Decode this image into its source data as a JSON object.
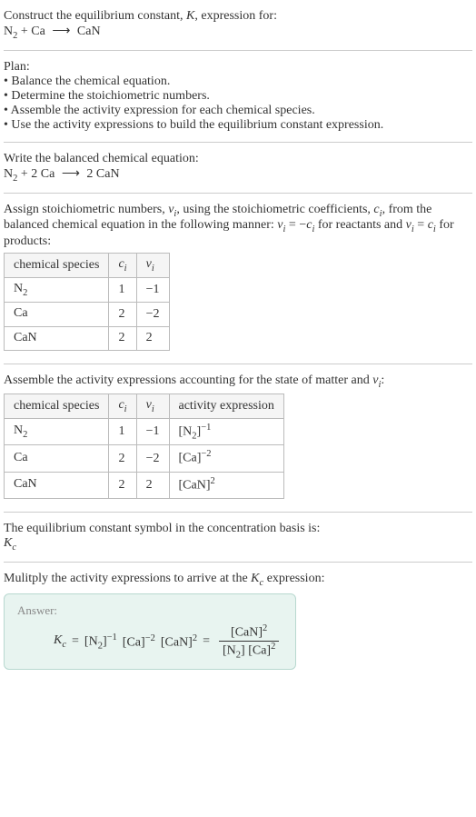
{
  "intro": {
    "line1": "Construct the equilibrium constant, ",
    "kvar": "K",
    "line1b": ", expression for:",
    "eq_lhs_n2": "N",
    "eq_lhs_sub2": "2",
    "eq_plus": " + Ca ",
    "eq_arrow": "⟶",
    "eq_rhs": " CaN"
  },
  "plan": {
    "title": "Plan:",
    "b1": "• Balance the chemical equation.",
    "b2": "• Determine the stoichiometric numbers.",
    "b3": "• Assemble the activity expression for each chemical species.",
    "b4": "• Use the activity expressions to build the equilibrium constant expression."
  },
  "balanced": {
    "title": "Write the balanced chemical equation:",
    "n2": "N",
    "sub2": "2",
    "plus": " + 2 Ca ",
    "arrow": "⟶",
    "rhs": " 2 CaN"
  },
  "stoich": {
    "text_a": "Assign stoichiometric numbers, ",
    "nui": "ν",
    "isub": "i",
    "text_b": ", using the stoichiometric coefficients, ",
    "ci": "c",
    "text_c": ", from the balanced chemical equation in the following manner: ",
    "eq1_lhs": "ν",
    "eq1_eq": " = −",
    "eq1_rhs": "c",
    "text_d": " for reactants and ",
    "eq2": " = ",
    "text_e": " for products:",
    "headers": {
      "h1": "chemical species",
      "h2": "c",
      "h3": "ν"
    },
    "rows": [
      {
        "sp_a": "N",
        "sp_sub": "2",
        "c": "1",
        "nu": "−1"
      },
      {
        "sp_a": "Ca",
        "sp_sub": "",
        "c": "2",
        "nu": "−2"
      },
      {
        "sp_a": "CaN",
        "sp_sub": "",
        "c": "2",
        "nu": "2"
      }
    ]
  },
  "activity": {
    "title_a": "Assemble the activity expressions accounting for the state of matter and ",
    "title_b": ":",
    "headers": {
      "h1": "chemical species",
      "h2": "c",
      "h3": "ν",
      "h4": "activity expression"
    },
    "rows": [
      {
        "sp_a": "N",
        "sp_sub": "2",
        "c": "1",
        "nu": "−1",
        "act_base_a": "[N",
        "act_base_sub": "2",
        "act_base_b": "]",
        "act_exp": "−1"
      },
      {
        "sp_a": "Ca",
        "sp_sub": "",
        "c": "2",
        "nu": "−2",
        "act_base_a": "[Ca",
        "act_base_sub": "",
        "act_base_b": "]",
        "act_exp": "−2"
      },
      {
        "sp_a": "CaN",
        "sp_sub": "",
        "c": "2",
        "nu": "2",
        "act_base_a": "[CaN",
        "act_base_sub": "",
        "act_base_b": "]",
        "act_exp": "2"
      }
    ]
  },
  "symbol": {
    "title": "The equilibrium constant symbol in the concentration basis is:",
    "kc_k": "K",
    "kc_c": "c"
  },
  "multiply": {
    "title_a": "Mulitply the activity expressions to arrive at the ",
    "title_b": " expression:"
  },
  "answer": {
    "label": "Answer:",
    "kc_k": "K",
    "kc_c": "c",
    "eq": " = ",
    "t1_a": "[N",
    "t1_sub": "2",
    "t1_b": "]",
    "t1_exp": "−1",
    "t2_a": "[Ca]",
    "t2_exp": "−2",
    "t3_a": "[CaN]",
    "t3_exp": "2",
    "eq2": " = ",
    "num_a": "[CaN]",
    "num_exp": "2",
    "den_a": "[N",
    "den_sub": "2",
    "den_b": "] [Ca]",
    "den_exp": "2"
  }
}
